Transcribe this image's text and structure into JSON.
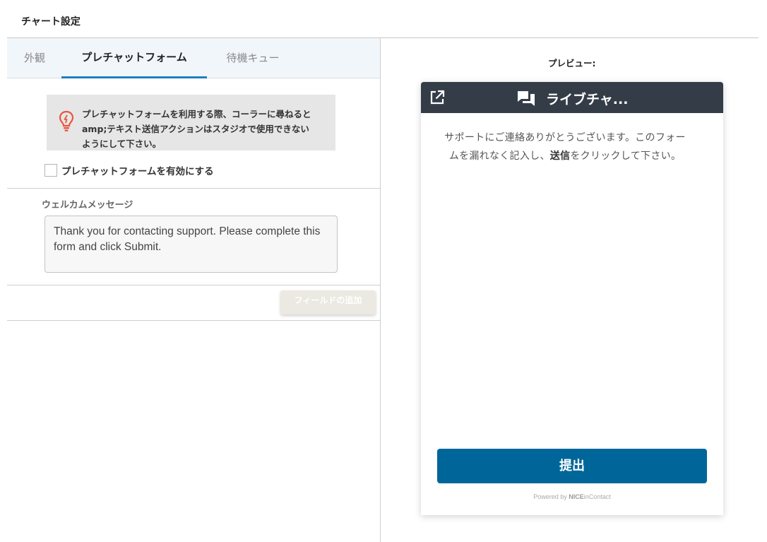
{
  "page": {
    "title": "チャート設定"
  },
  "tabs": [
    {
      "label": "外観",
      "active": false
    },
    {
      "label": "プレチャットフォーム",
      "active": true
    },
    {
      "label": "待機キュー",
      "active": false
    }
  ],
  "hint": {
    "icon": "lightbulb-icon",
    "line1": "プレチャットフォームを利用する際、コーラーに尋ねると",
    "line2": "amp;テキスト送信アクションはスタジオで使用できない",
    "line3": "ようにして下さい。"
  },
  "enable_prechat": {
    "label": "プレチャットフォームを有効にする",
    "checked": false
  },
  "welcome": {
    "label": "ウェルカムメッセージ",
    "value": "Thank you for contacting support. Please complete this form and click Submit."
  },
  "add_field": {
    "label": "フィールドの追加"
  },
  "preview": {
    "label": "プレビュー:",
    "widget_title": "ライブチャ...",
    "message_pre": "サポートにご連絡ありがとうございます。このフォームを漏れなく記入し、",
    "message_bold": "送信",
    "message_post": "をクリックして下さい。",
    "submit_label": "提出",
    "powered_by": "Powered by",
    "brand": "NICE",
    "brand_suffix": "inContact"
  },
  "colors": {
    "accent": "#1f7fc0",
    "submit": "#006699",
    "header": "#343d47",
    "hint_icon": "#e8553e"
  }
}
